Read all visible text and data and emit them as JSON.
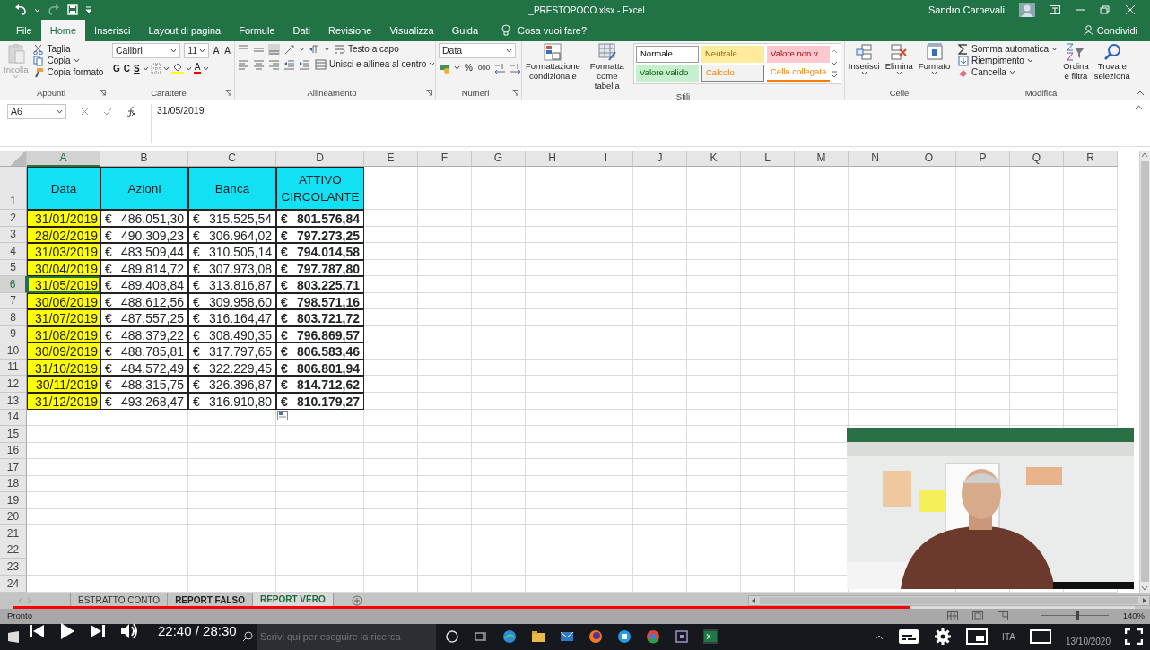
{
  "titlebar": {
    "title": "_PRESTOPOCO.xlsx  -  Excel",
    "user": "Sandro Carnevali"
  },
  "menu": {
    "tabs": [
      {
        "label": "File",
        "selected": false
      },
      {
        "label": "Home",
        "selected": true
      },
      {
        "label": "Inserisci",
        "selected": false
      },
      {
        "label": "Layout di pagina",
        "selected": false
      },
      {
        "label": "Formule",
        "selected": false
      },
      {
        "label": "Dati",
        "selected": false
      },
      {
        "label": "Revisione",
        "selected": false
      },
      {
        "label": "Visualizza",
        "selected": false
      },
      {
        "label": "Guida",
        "selected": false
      }
    ],
    "tell_me": "Cosa vuoi fare?",
    "share": "Condividi"
  },
  "ribbon": {
    "clipboard": {
      "label": "Appunti",
      "paste": {
        "label": "Incolla",
        "disabled": true
      },
      "items": [
        "Taglia",
        "Copia",
        "Copia formato"
      ]
    },
    "font": {
      "label": "Carattere",
      "font": "Calibri",
      "size": "11",
      "grow": "A",
      "shrink": "A",
      "bold": "G",
      "italic": "C",
      "underline": "S",
      "font_color": "A"
    },
    "alignment": {
      "label": "Allineamento",
      "wrap": "Testo a capo",
      "merge": "Unisci e allinea al centro"
    },
    "number": {
      "label": "Numeri",
      "format": "Data",
      "percent": "%",
      "thousands": "000"
    },
    "styles": {
      "label": "Stili",
      "conditional": "Formattazione condizionale",
      "table": "Formatta come tabella",
      "cell_styles": [
        {
          "label": "Normale",
          "kind": "normal"
        },
        {
          "label": "Neutrale",
          "kind": "neutral"
        },
        {
          "label": "Valore non v...",
          "kind": "bad"
        },
        {
          "label": "Valore valido",
          "kind": "good"
        },
        {
          "label": "Calcolo",
          "kind": "calc"
        },
        {
          "label": "Cella collegata",
          "kind": "linked"
        }
      ]
    },
    "cells": {
      "label": "Celle",
      "buttons": [
        "Inserisci",
        "Elimina",
        "Formato"
      ]
    },
    "editing": {
      "label": "Modifica",
      "items": [
        "Somma automatica",
        "Riempimento",
        "Cancella"
      ],
      "sort": "Ordina e filtra",
      "find": "Trova e seleziona"
    }
  },
  "formula_bar": {
    "name_box": "A6",
    "formula": "31/05/2019"
  },
  "sheet": {
    "columns": [
      {
        "label": "A",
        "selected": true
      },
      {
        "label": "B",
        "selected": false
      },
      {
        "label": "C",
        "selected": false
      },
      {
        "label": "D",
        "selected": false
      },
      {
        "label": "E",
        "selected": false
      },
      {
        "label": "F",
        "selected": false
      },
      {
        "label": "G",
        "selected": false
      },
      {
        "label": "H",
        "selected": false
      },
      {
        "label": "I",
        "selected": false
      },
      {
        "label": "J",
        "selected": false
      },
      {
        "label": "K",
        "selected": false
      },
      {
        "label": "L",
        "selected": false
      },
      {
        "label": "M",
        "selected": false
      },
      {
        "label": "N",
        "selected": false
      },
      {
        "label": "O",
        "selected": false
      },
      {
        "label": "P",
        "selected": false
      },
      {
        "label": "Q",
        "selected": false
      },
      {
        "label": "R",
        "selected": false
      }
    ],
    "rows": [
      {
        "label": "1",
        "selected": false
      },
      {
        "label": "2",
        "selected": false
      },
      {
        "label": "3",
        "selected": false
      },
      {
        "label": "4",
        "selected": false
      },
      {
        "label": "5",
        "selected": false
      },
      {
        "label": "6",
        "selected": true
      },
      {
        "label": "7",
        "selected": false
      },
      {
        "label": "8",
        "selected": false
      },
      {
        "label": "9",
        "selected": false
      },
      {
        "label": "10",
        "selected": false
      },
      {
        "label": "11",
        "selected": false
      },
      {
        "label": "12",
        "selected": false
      },
      {
        "label": "13",
        "selected": false
      },
      {
        "label": "14",
        "selected": false
      },
      {
        "label": "15",
        "selected": false
      },
      {
        "label": "16",
        "selected": false
      },
      {
        "label": "17",
        "selected": false
      },
      {
        "label": "18",
        "selected": false
      },
      {
        "label": "19",
        "selected": false
      },
      {
        "label": "20",
        "selected": false
      },
      {
        "label": "21",
        "selected": false
      },
      {
        "label": "22",
        "selected": false
      },
      {
        "label": "23",
        "selected": false
      },
      {
        "label": "24",
        "selected": false
      }
    ],
    "header": [
      "Data",
      "Azioni",
      "Banca",
      "ATTIVO CIRCOLANTE"
    ],
    "data": [
      [
        "31/01/2019",
        "€",
        "486.051,30",
        "€",
        "315.525,54",
        "€",
        "801.576,84"
      ],
      [
        "28/02/2019",
        "€",
        "490.309,23",
        "€",
        "306.964,02",
        "€",
        "797.273,25"
      ],
      [
        "31/03/2019",
        "€",
        "483.509,44",
        "€",
        "310.505,14",
        "€",
        "794.014,58"
      ],
      [
        "30/04/2019",
        "€",
        "489.814,72",
        "€",
        "307.973,08",
        "€",
        "797.787,80"
      ],
      [
        "31/05/2019",
        "€",
        "489.408,84",
        "€",
        "313.816,87",
        "€",
        "803.225,71"
      ],
      [
        "30/06/2019",
        "€",
        "488.612,56",
        "€",
        "309.958,60",
        "€",
        "798.571,16"
      ],
      [
        "31/07/2019",
        "€",
        "487.557,25",
        "€",
        "316.164,47",
        "€",
        "803.721,72"
      ],
      [
        "31/08/2019",
        "€",
        "488.379,22",
        "€",
        "308.490,35",
        "€",
        "796.869,57"
      ],
      [
        "30/09/2019",
        "€",
        "488.785,81",
        "€",
        "317.797,65",
        "€",
        "806.583,46"
      ],
      [
        "31/10/2019",
        "€",
        "484.572,49",
        "€",
        "322.229,45",
        "€",
        "806.801,94"
      ],
      [
        "30/11/2019",
        "€",
        "488.315,75",
        "€",
        "326.396,87",
        "€",
        "814.712,62"
      ],
      [
        "31/12/2019",
        "€",
        "493.268,47",
        "€",
        "316.910,80",
        "€",
        "810.179,27"
      ]
    ]
  },
  "sheet_tabs": [
    {
      "label": "ESTRATTO CONTO",
      "selected": false,
      "hovered": false
    },
    {
      "label": "REPORT FALSO",
      "selected": false,
      "hovered": true
    },
    {
      "label": "REPORT VERO",
      "selected": true,
      "hovered": false
    }
  ],
  "status": {
    "text": "Pronto",
    "zoom": "140%",
    "zoom_slider": {
      "level": 0.55
    }
  },
  "player": {
    "progress": {
      "level": 0.8
    },
    "time": "22:40 / 28:30"
  },
  "taskbar": {
    "search_placeholder": "Scrivi qui per eseguire la ricerca",
    "language": "ITA",
    "date": "13/10/2020"
  }
}
